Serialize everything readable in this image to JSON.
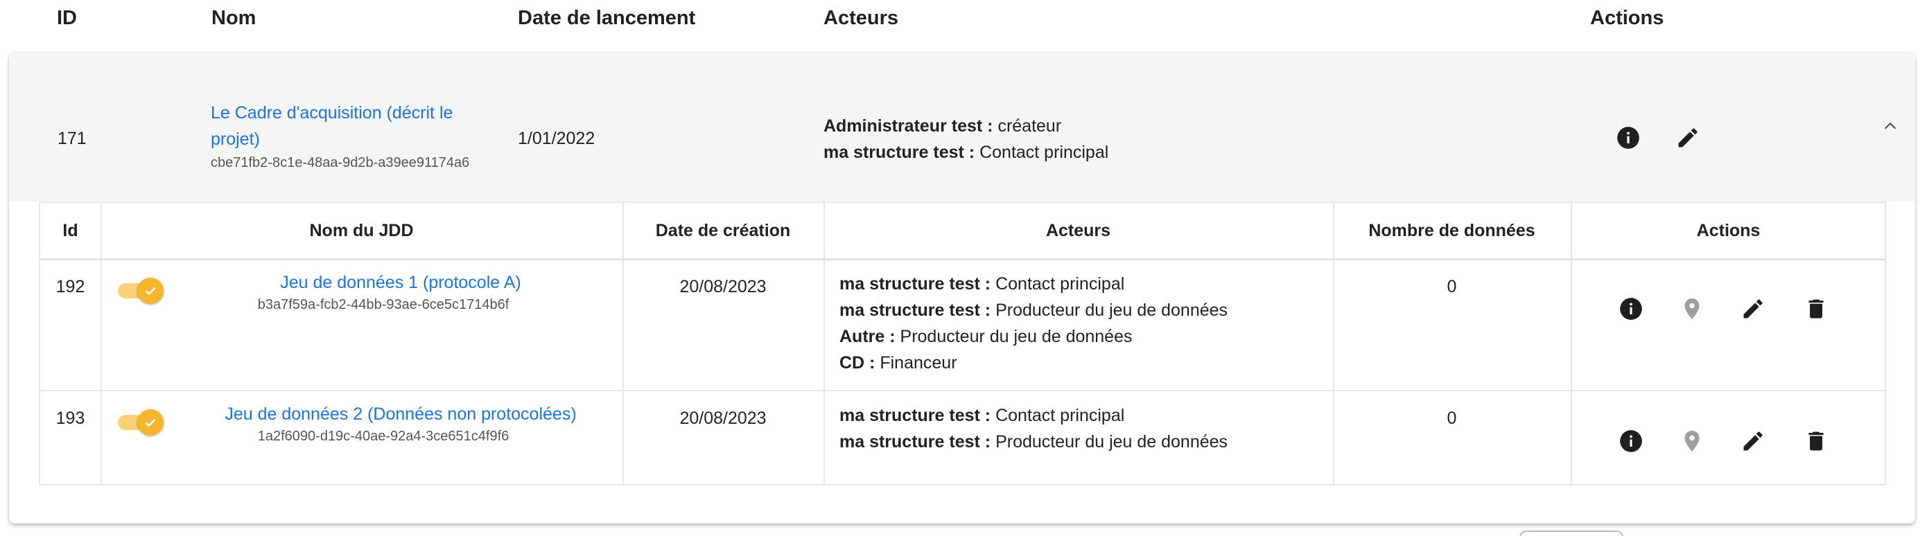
{
  "outer_headers": {
    "id": "ID",
    "nom": "Nom",
    "date": "Date de lancement",
    "acteurs": "Acteurs",
    "actions": "Actions"
  },
  "acquisition": {
    "id": "171",
    "name": "Le Cadre d'acquisition (décrit le projet)",
    "name_line1": "Le Cadre d'acquisition (décrit le",
    "name_line2": "projet)",
    "uuid": "cbe71fb2-8c1e-48aa-9d2b-a39ee91174a6",
    "date": "1/01/2022",
    "actors": [
      {
        "name": "Administrateur test :",
        "role": "créateur"
      },
      {
        "name": "ma structure test :",
        "role": "Contact principal"
      }
    ],
    "icons": {
      "info": "info-icon",
      "edit": "pencil-icon",
      "collapse": "chevron-up-icon"
    }
  },
  "inner_headers": {
    "id": "Id",
    "nom": "Nom du JDD",
    "date": "Date de création",
    "acteurs": "Acteurs",
    "nb": "Nombre de données",
    "actions": "Actions"
  },
  "datasets": [
    {
      "id": "192",
      "active": true,
      "name": "Jeu de données 1 (protocole A)",
      "uuid": "b3a7f59a-fcb2-44bb-93ae-6ce5c1714b6f",
      "date": "20/08/2023",
      "actors": [
        {
          "name": "ma structure test :",
          "role": "Contact principal"
        },
        {
          "name": "ma structure test :",
          "role": "Producteur du jeu de données"
        },
        {
          "name": "Autre :",
          "role": "Producteur du jeu de données"
        },
        {
          "name": "CD :",
          "role": "Financeur"
        }
      ],
      "count": "0"
    },
    {
      "id": "193",
      "active": true,
      "name": "Jeu de données 2 (Données non protocolées)",
      "uuid": "1a2f6090-d19c-40ae-92a4-3ce651c4f9f6",
      "date": "20/08/2023",
      "actors": [
        {
          "name": "ma structure test :",
          "role": "Contact principal"
        },
        {
          "name": "ma structure test :",
          "role": "Producteur du jeu de données"
        }
      ],
      "count": "0"
    }
  ],
  "colors": {
    "link": "#1a73e8",
    "toggle_thumb": "#f7b52b",
    "toggle_track": "#fbd178",
    "header_bg": "#f5f5f5",
    "icon_dark": "#1f1f1f",
    "icon_muted": "#9e9e9e"
  }
}
